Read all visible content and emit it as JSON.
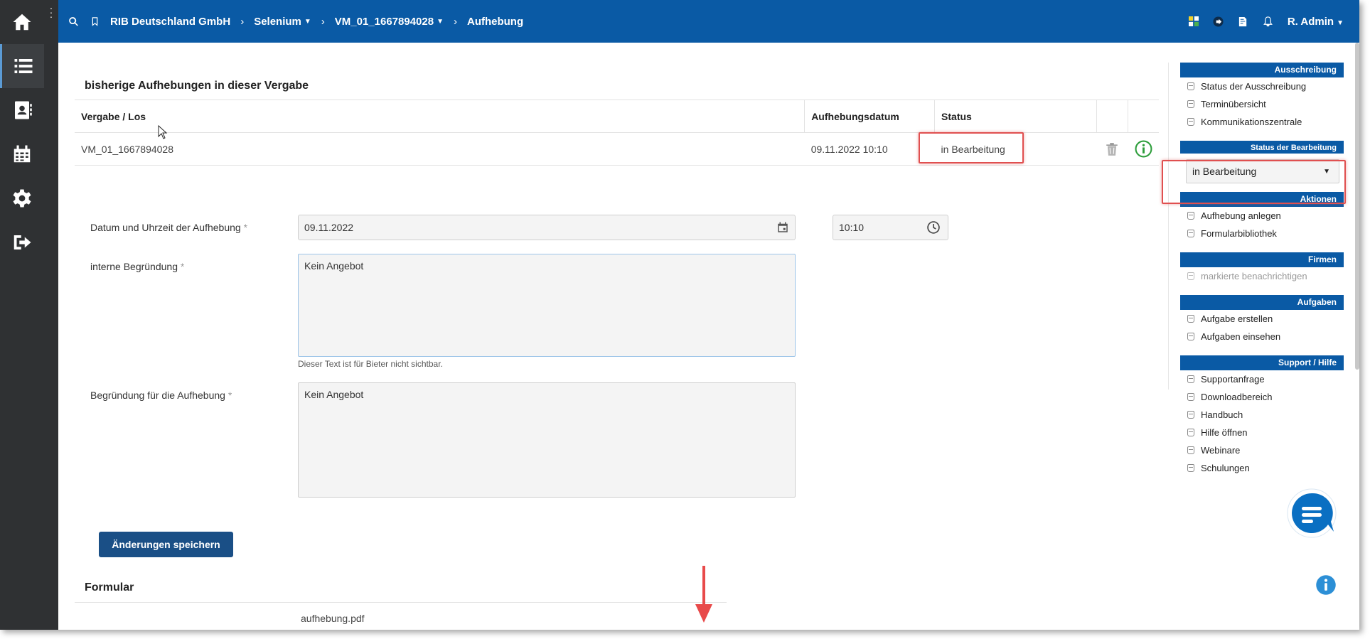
{
  "header": {
    "breadcrumbs": [
      {
        "label": "RIB Deutschland GmbH",
        "dropdown": false
      },
      {
        "label": "Selenium",
        "dropdown": true
      },
      {
        "label": "VM_01_1667894028",
        "dropdown": true
      },
      {
        "label": "Aufhebung",
        "dropdown": false
      }
    ],
    "user": "R. Admin"
  },
  "history": {
    "title": "bisherige Aufhebungen in dieser Vergabe",
    "columns": [
      "Vergabe / Los",
      "Aufhebungsdatum",
      "Status"
    ],
    "rows": [
      {
        "vergabe": "VM_01_1667894028",
        "datum": "09.11.2022 10:10",
        "status": "in Bearbeitung"
      }
    ]
  },
  "form": {
    "date_label": "Datum und Uhrzeit der Aufhebung",
    "date_value": "09.11.2022",
    "time_value": "10:10",
    "internal_label": "interne Begründung",
    "internal_value": "Kein Angebot",
    "internal_hint": "Dieser Text ist für Bieter nicht sichtbar.",
    "reason_label": "Begründung für die Aufhebung",
    "reason_value": "Kein Angebot",
    "required_mark": "*",
    "save_label": "Änderungen speichern"
  },
  "formular": {
    "title": "Formular",
    "file": "aufhebung.pdf"
  },
  "sidebar": {
    "ausschreibung": {
      "title": "Ausschreibung",
      "items": [
        "Status der Ausschreibung",
        "Terminübersicht",
        "Kommunikationszentrale"
      ]
    },
    "status": {
      "title": "Status der Bearbeitung",
      "value": "in Bearbeitung"
    },
    "aktionen": {
      "title": "Aktionen",
      "items": [
        "Aufhebung anlegen",
        "Formularbibliothek"
      ]
    },
    "firmen": {
      "title": "Firmen",
      "items": [
        "markierte benachrichtigen"
      ]
    },
    "aufgaben": {
      "title": "Aufgaben",
      "items": [
        "Aufgabe erstellen",
        "Aufgaben einsehen"
      ]
    },
    "support": {
      "title": "Support / Hilfe",
      "items": [
        "Supportanfrage",
        "Downloadbereich",
        "Handbuch",
        "Hilfe öffnen",
        "Webinare",
        "Schulungen"
      ]
    }
  },
  "colors": {
    "brand": "#0a5aa5",
    "rail": "#2f3133",
    "annotation": "#e05050",
    "success": "#2e9e3c",
    "chat": "#0a6fc2"
  }
}
